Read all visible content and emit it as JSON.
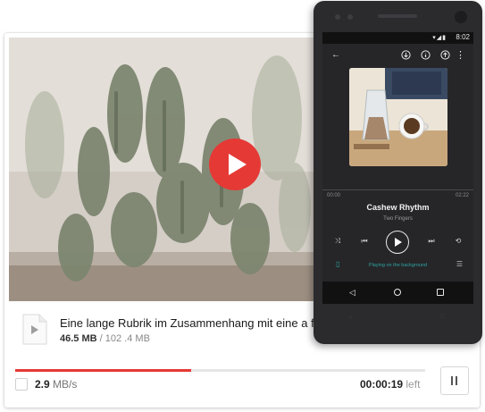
{
  "colors": {
    "accent": "#e53935",
    "teal": "#2ea3a0",
    "phone_body": "#2b2b2e",
    "player_bg": "#262629"
  },
  "download": {
    "title": "Eine lange Rubrik im Zusammenhang mit eine a few",
    "size_current": "46.5 MB",
    "size_separator": "/",
    "size_total": "102 .4 MB",
    "progress_fraction": 0.43,
    "speed_value": "2.9",
    "speed_unit": "MB/s",
    "time_remaining": "00:00:19",
    "time_remaining_label": "left",
    "icons": {
      "video_play": "play-icon",
      "file": "file-play-icon",
      "pause": "pause-icon"
    }
  },
  "phone": {
    "status_time": "8:02",
    "player": {
      "time_start": "00:00",
      "time_end": "02:22",
      "song_title": "Cashew Rhythm",
      "artist": "Two Fingers",
      "background_label": "Playing on the background"
    },
    "icons": {
      "back": "arrow-left-icon",
      "download": "download-icon",
      "info": "info-icon",
      "share": "share-icon",
      "more": "more-vert-icon",
      "shuffle": "shuffle-icon",
      "previous": "skip-previous-icon",
      "play": "play-icon",
      "next": "skip-next-icon",
      "repeat": "repeat-icon",
      "background": "phone-background-icon",
      "queue": "queue-icon"
    }
  }
}
